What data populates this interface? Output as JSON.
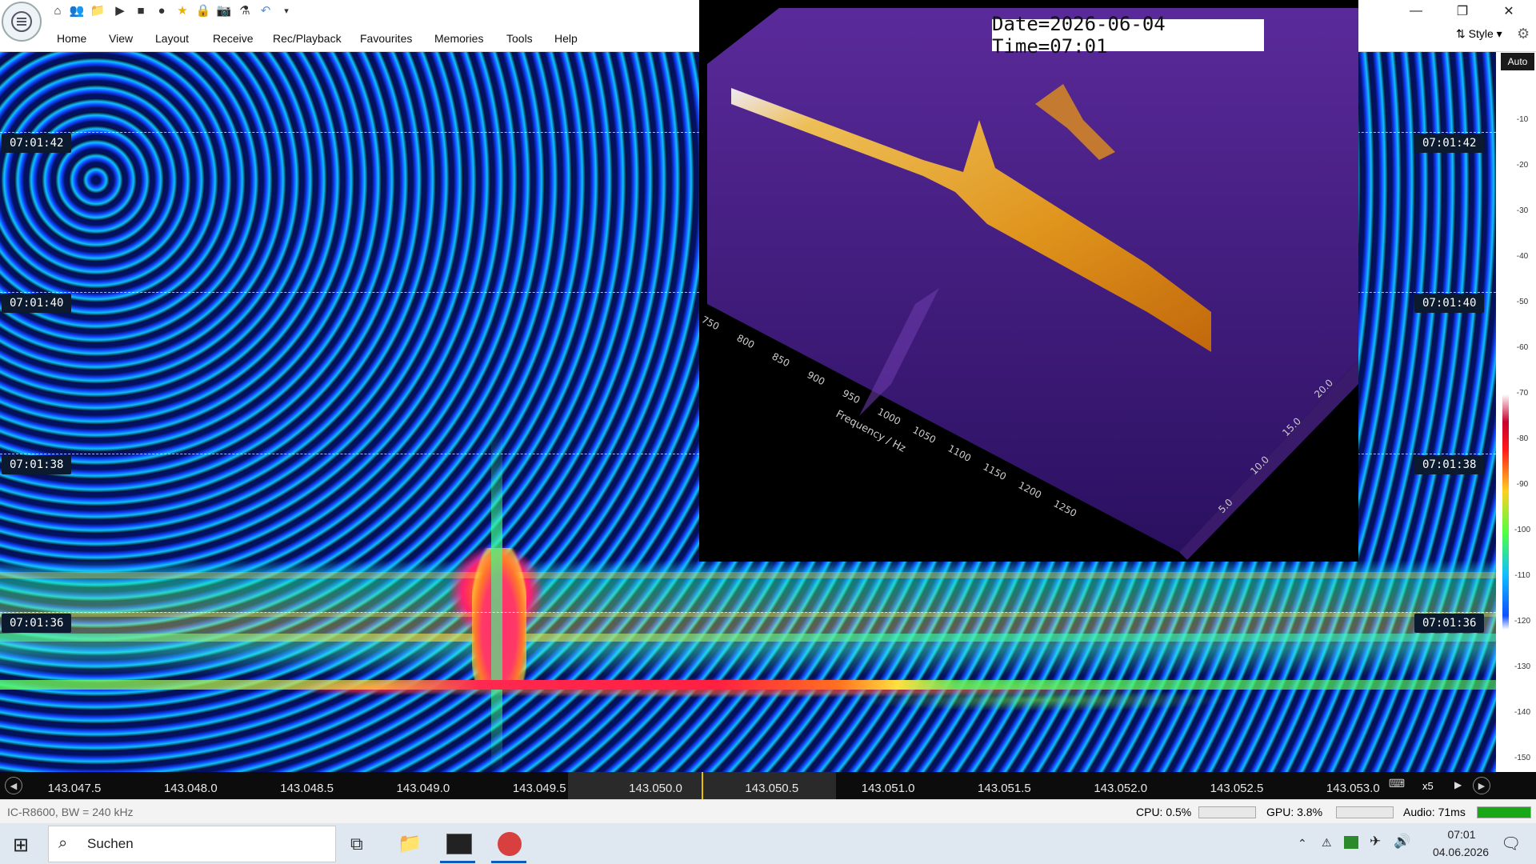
{
  "window": {
    "menu": [
      "Home",
      "View",
      "Layout",
      "Receive",
      "Rec/Playback",
      "Favourites",
      "Memories",
      "Tools",
      "Help"
    ],
    "style_label": "Style",
    "quick_access_icons": [
      "home-icon",
      "users-icon",
      "folder-icon",
      "play-icon",
      "stop-icon",
      "record-icon",
      "star-icon",
      "lock-icon",
      "camera-icon",
      "flask-icon",
      "undo-icon",
      "dropdown-icon"
    ],
    "controls": [
      "minimize-icon",
      "restore-icon",
      "close-icon"
    ]
  },
  "waterfall": {
    "time_labels": [
      "07:01:42",
      "07:01:40",
      "07:01:38",
      "07:01:36"
    ],
    "scale_mode": "Auto",
    "dbm_scale": [
      "-10",
      "-20",
      "-30",
      "-40",
      "-50",
      "-60",
      "-70",
      "-80",
      "-90",
      "-100",
      "-110",
      "-120",
      "-130",
      "-140",
      "-150"
    ]
  },
  "overlay": {
    "date_stamp": "Date=2026-06-04 Time=07:01",
    "frequency_axis_label": "Frequency / Hz",
    "frequency_ticks": [
      "750",
      "800",
      "850",
      "900",
      "950",
      "1000",
      "1050",
      "1100",
      "1150",
      "1200",
      "1250"
    ],
    "time_ticks": [
      "5.0",
      "10.0",
      "15.0",
      "20.0"
    ]
  },
  "frequency_axis": {
    "ticks": [
      "143.047.5",
      "143.048.0",
      "143.048.5",
      "143.049.0",
      "143.049.5",
      "143.050.0",
      "143.050.5",
      "143.051.0",
      "143.051.5",
      "143.052.0",
      "143.052.5",
      "143.053.0"
    ],
    "zoom": "x5"
  },
  "status_bar": {
    "device": "IC-R8600, BW = 240 kHz",
    "cpu": "CPU: 0.5%",
    "gpu": "GPU: 3.8%",
    "audio": "Audio: 71ms"
  },
  "taskbar": {
    "search_placeholder": "Suchen",
    "time": "07:01",
    "date": "04.06.2026"
  }
}
